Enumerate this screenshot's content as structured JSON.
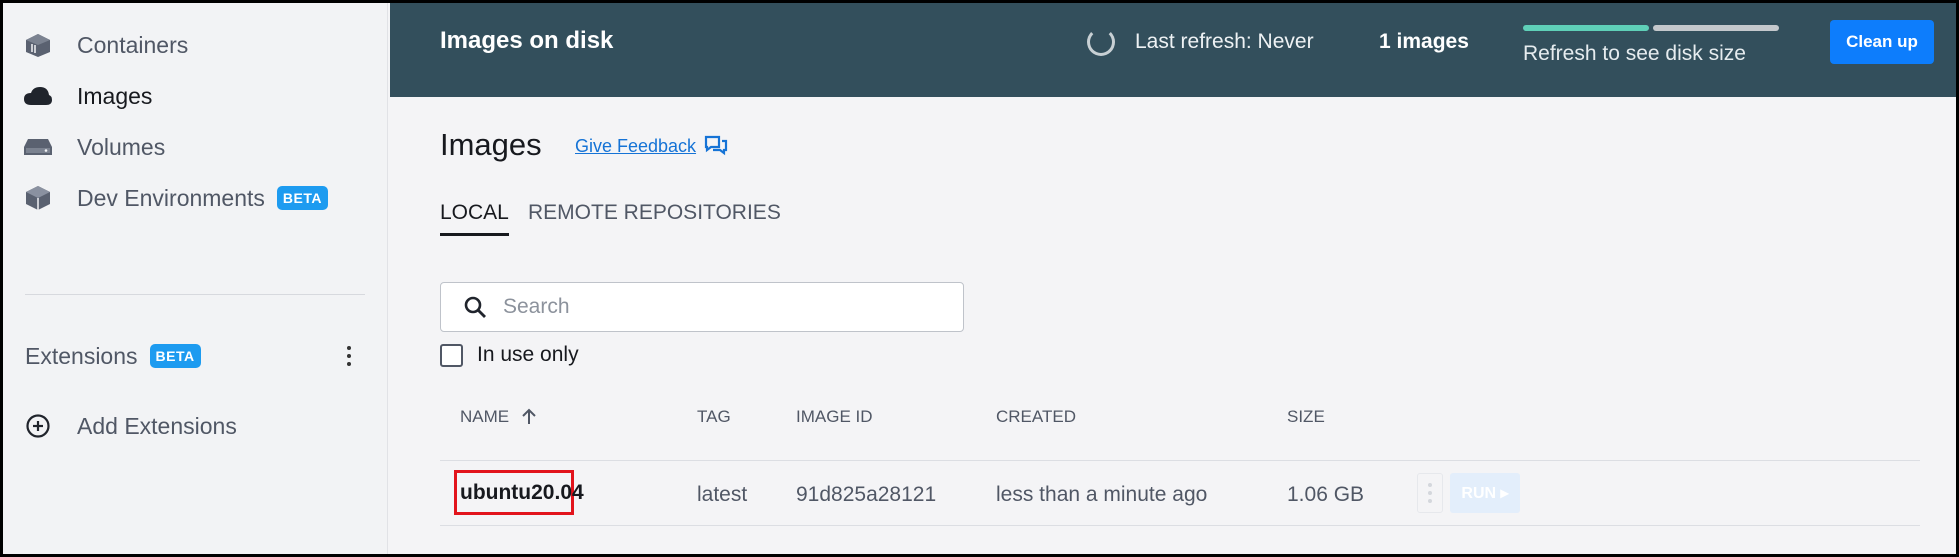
{
  "sidebar": {
    "items": [
      {
        "label": "Containers",
        "icon": "containers-icon"
      },
      {
        "label": "Images",
        "icon": "cloud-icon",
        "active": true
      },
      {
        "label": "Volumes",
        "icon": "drive-icon"
      },
      {
        "label": "Dev Environments",
        "icon": "cube-icon",
        "badge": "BETA"
      }
    ],
    "extensions": {
      "label": "Extensions",
      "badge": "BETA"
    },
    "add_extensions": {
      "label": "Add Extensions",
      "icon": "plus-circle-icon"
    }
  },
  "topbar": {
    "title": "Images on disk",
    "last_refresh": "Last refresh: Never",
    "image_count": "1 images",
    "disk_text": "Refresh to see disk size",
    "cleanup_label": "Clean up"
  },
  "main": {
    "heading": "Images",
    "feedback": "Give Feedback",
    "tabs": [
      {
        "label": "LOCAL",
        "active": true
      },
      {
        "label": "REMOTE REPOSITORIES",
        "active": false
      }
    ],
    "search": {
      "placeholder": "Search",
      "value": ""
    },
    "in_use_only": {
      "label": "In use only",
      "checked": false
    },
    "table": {
      "columns": [
        "NAME",
        "TAG",
        "IMAGE ID",
        "CREATED",
        "SIZE"
      ],
      "rows": [
        {
          "name": "ubuntu20.04",
          "tag": "latest",
          "image_id": "91d825a28121",
          "created": "less than a minute ago",
          "size": "1.06 GB",
          "run_label": "RUN"
        }
      ]
    }
  },
  "colors": {
    "topbar": "#334f5c",
    "accent": "#0d7dfc",
    "beta": "#1d9bf0",
    "highlight": "#e2141c"
  }
}
